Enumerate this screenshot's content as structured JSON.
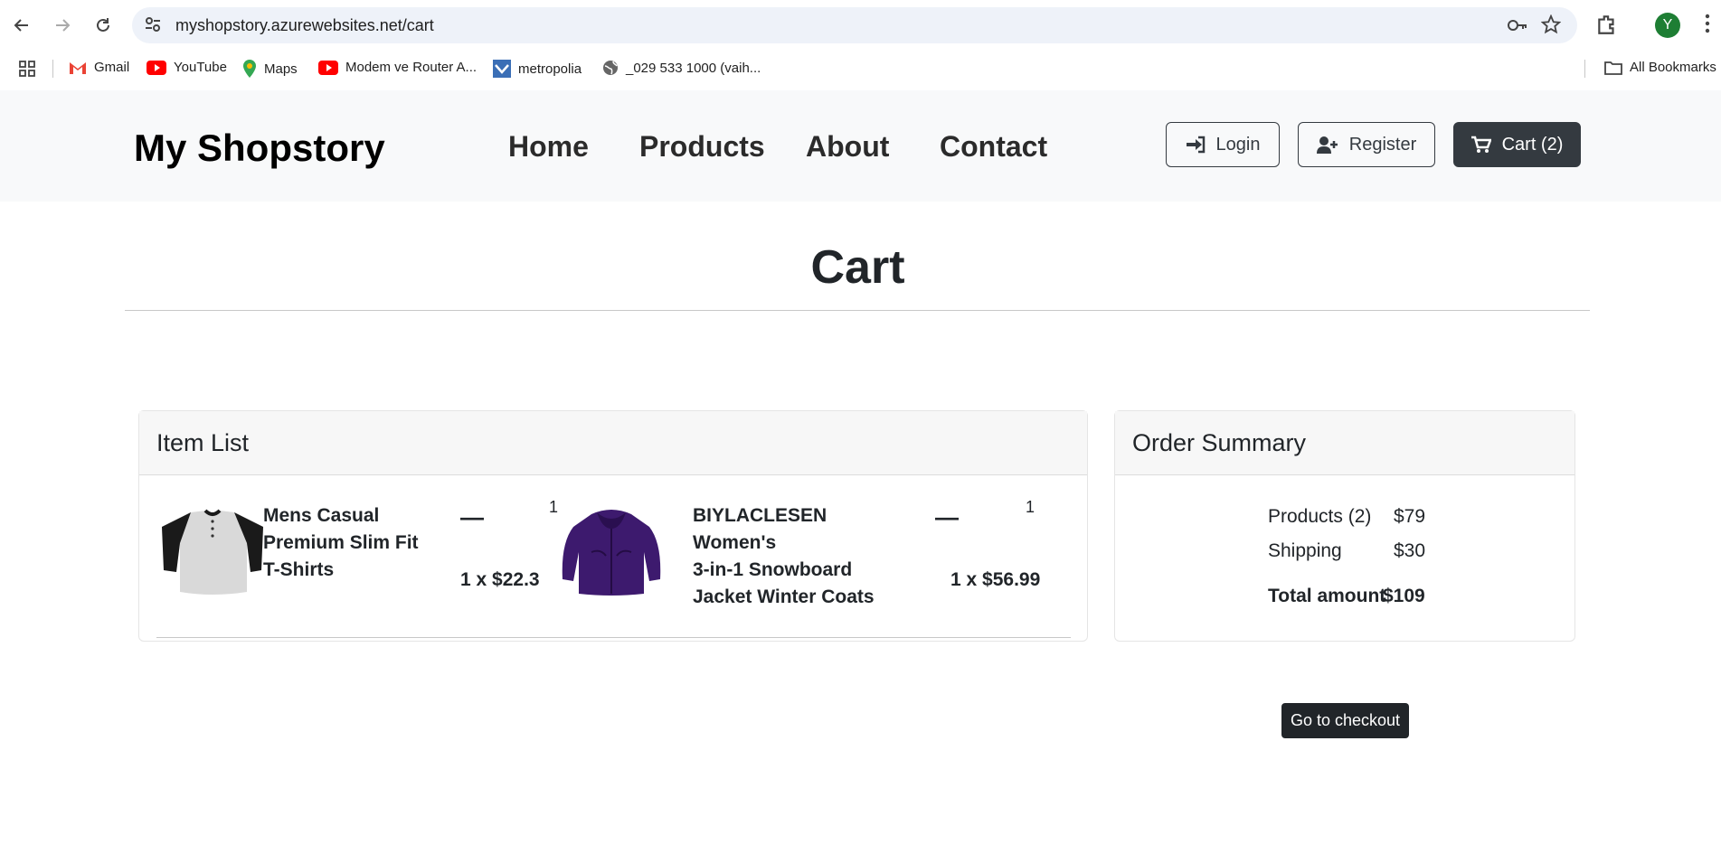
{
  "browser": {
    "url": "myshopstory.azurewebsites.net/cart",
    "avatar_letter": "Y",
    "bookmarks": [
      {
        "label": "Gmail",
        "icon": "gmail-icon"
      },
      {
        "label": "YouTube",
        "icon": "youtube-icon"
      },
      {
        "label": "Maps",
        "icon": "maps-icon"
      },
      {
        "label": "Modem ve Router A...",
        "icon": "youtube-icon"
      },
      {
        "label": "metropolia",
        "icon": "metropolia-icon"
      },
      {
        "label": "_029 533 1000 (vaih...",
        "icon": "globe-icon"
      }
    ],
    "all_bookmarks": "All Bookmarks"
  },
  "header": {
    "brand": "My Shopstory",
    "nav": [
      "Home",
      "Products",
      "About",
      "Contact"
    ],
    "login": "Login",
    "register": "Register",
    "cart": "Cart (2)"
  },
  "page": {
    "title": "Cart"
  },
  "item_list": {
    "heading": "Item List",
    "items": [
      {
        "name_lines": [
          "Mens Casual",
          "Premium Slim Fit",
          "T-Shirts"
        ],
        "qty": "1",
        "price": "1 x $22.3",
        "minus": "—"
      },
      {
        "name_lines": [
          "BIYLACLESEN Women's",
          "3-in-1 Snowboard",
          "Jacket Winter Coats"
        ],
        "qty": "1",
        "price": "1 x $56.99",
        "minus": "—"
      }
    ]
  },
  "summary": {
    "heading": "Order Summary",
    "products_label": "Products (2)",
    "products_value": "$79",
    "shipping_label": "Shipping",
    "shipping_value": "$30",
    "total_label": "Total amount",
    "total_value": "$109",
    "checkout": "Go to checkout"
  },
  "colors": {
    "header_bg": "#f8f9fa",
    "dark_button": "#343a40",
    "checkout_bg": "#212529",
    "jacket_purple": "#3d1a6e",
    "avatar_green": "#1e7e34"
  }
}
